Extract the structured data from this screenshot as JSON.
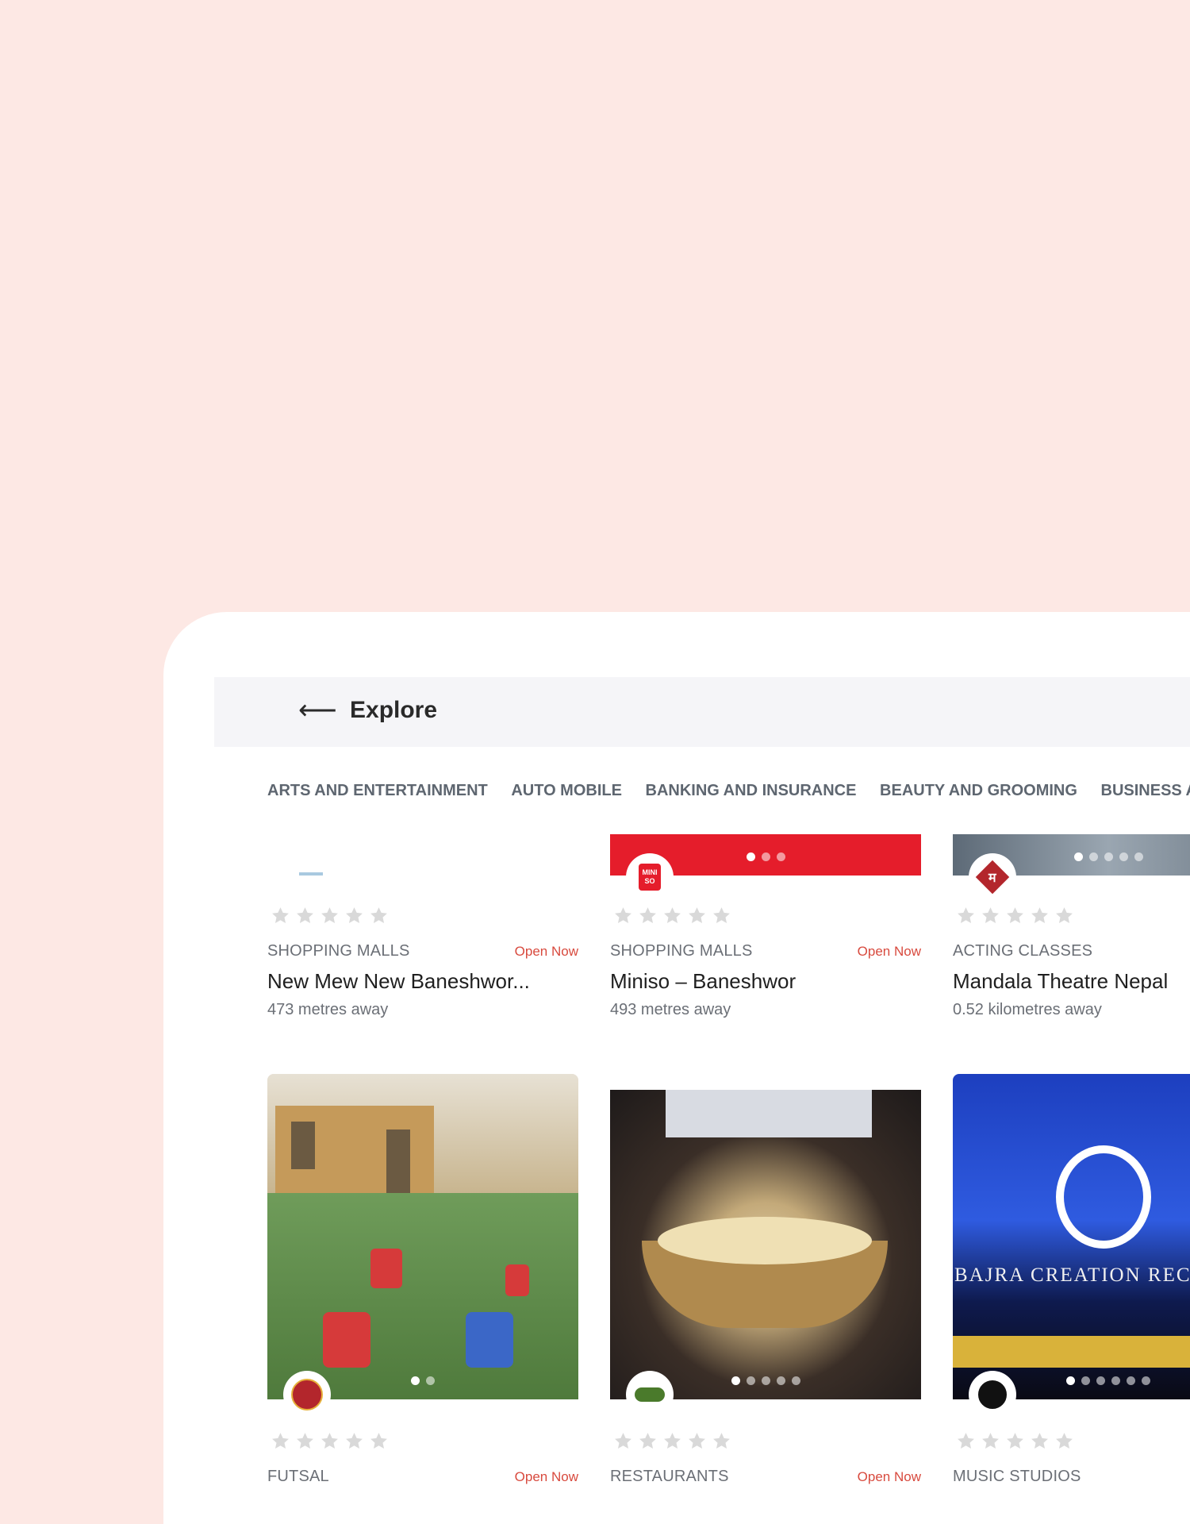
{
  "header": {
    "back_icon": "arrow-left-icon",
    "back_glyph": "⟵",
    "title": "Explore"
  },
  "categories": [
    "ARTS AND ENTERTAINMENT",
    "AUTO MOBILE",
    "BANKING AND INSURANCE",
    "BEAUTY AND GROOMING",
    "BUSINESS AND FI"
  ],
  "colors": {
    "background": "#fde8e4",
    "open_now": "#d84a3e",
    "miniso_red": "#e51d2b"
  },
  "cards_row1": [
    {
      "category": "SHOPPING MALLS",
      "status": "Open Now",
      "name": "New Mew New Baneshwor...",
      "distance": "473 metres away",
      "rating": 0
    },
    {
      "category": "SHOPPING MALLS",
      "status": "Open Now",
      "name": "Miniso – Baneshwor",
      "distance": "493 metres away",
      "rating": 0,
      "logo_text": "MINI\nSO"
    },
    {
      "category": "ACTING CLASSES",
      "status": "",
      "name": "Mandala Theatre Nepal",
      "distance": "0.52 kilometres away",
      "rating": 0,
      "logo_text": "म"
    }
  ],
  "cards_row2": [
    {
      "category": "FUTSAL",
      "status": "Open Now",
      "rating": 0
    },
    {
      "category": "RESTAURANTS",
      "status": "Open Now",
      "rating": 0
    },
    {
      "category": "MUSIC STUDIOS",
      "status": "",
      "rating": 0,
      "banner_text": "BAJRA CREATION REC"
    }
  ]
}
